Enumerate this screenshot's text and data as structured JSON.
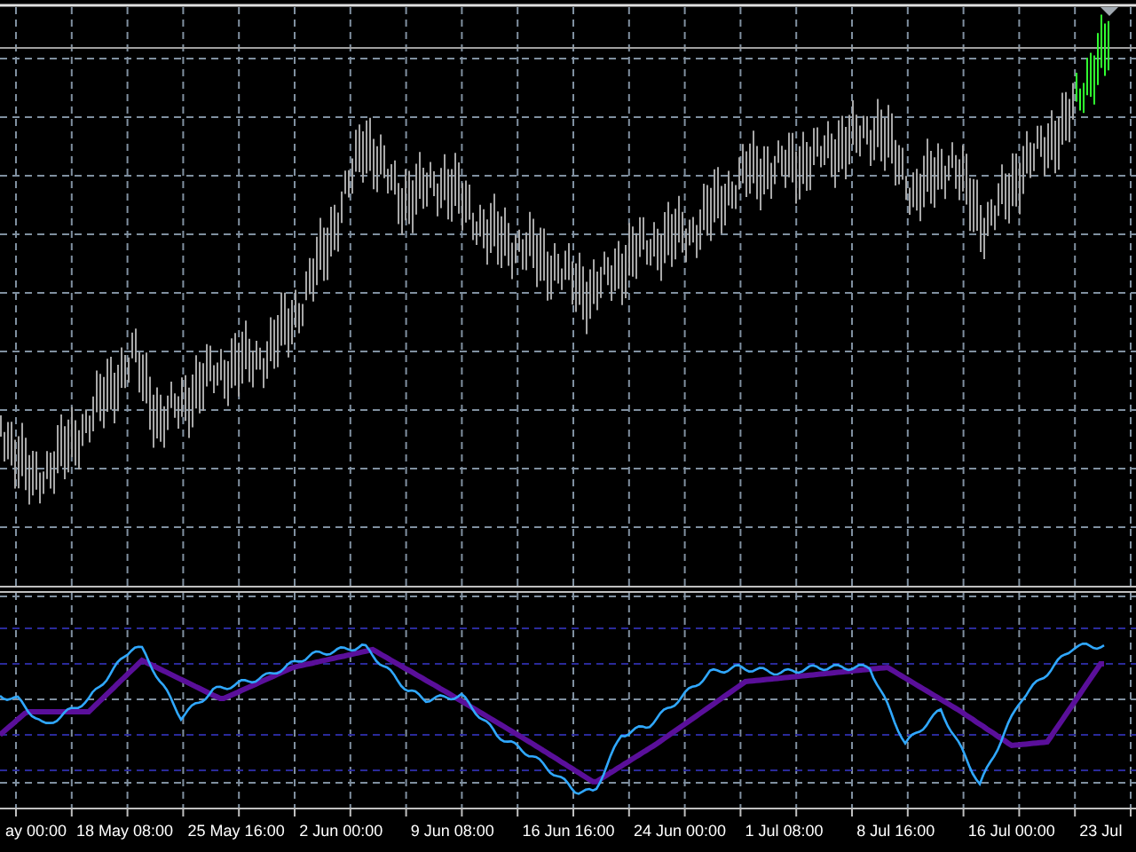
{
  "time_axis": {
    "labels": [
      "ay 00:00",
      "18 May 08:00",
      "25 May 16:00",
      "2 Jun 00:00",
      "9 Jun 08:00",
      "16 Jun 16:00",
      "24 Jun 00:00",
      "1 Jul 08:00",
      "8 Jul 16:00",
      "16 Jul 00:00",
      "23 Jul"
    ]
  }
}
